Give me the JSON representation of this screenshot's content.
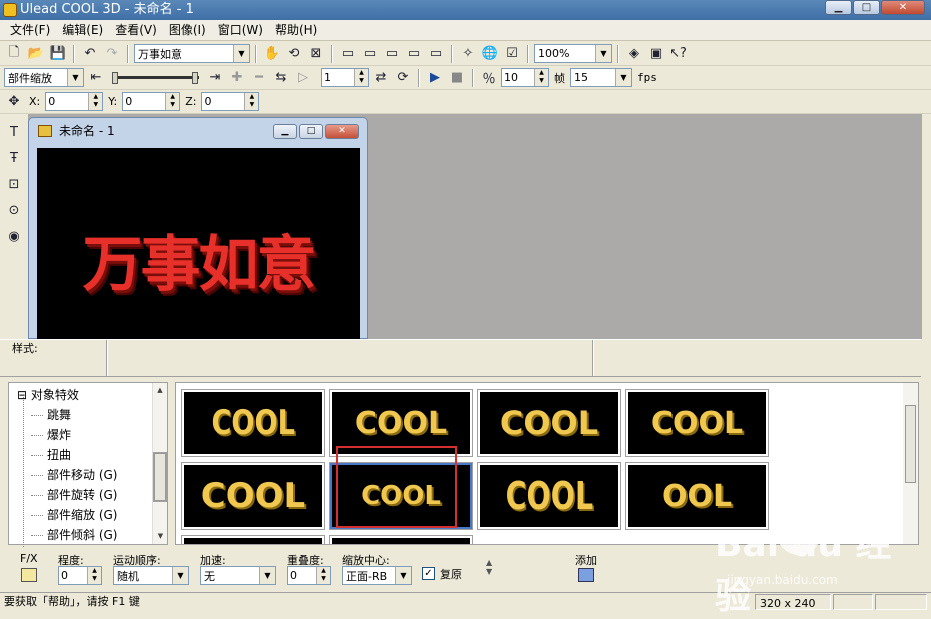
{
  "window": {
    "title": "Ulead COOL 3D - 未命名 - 1"
  },
  "menu": [
    "文件(F)",
    "编辑(E)",
    "查看(V)",
    "图像(I)",
    "窗口(W)",
    "帮助(H)"
  ],
  "toolbar1": {
    "text_combo": "万事如意",
    "zoom": "100%"
  },
  "toolbar2": {
    "mode_combo": "部件缩放",
    "frame": "1",
    "fps_value": "10",
    "frame_label": "帧",
    "frames_total": "15",
    "fps_label": "fps"
  },
  "toolbar3": {
    "x_label": "X:",
    "x": "0",
    "y_label": "Y:",
    "y": "0",
    "z_label": "Z:",
    "z": "0"
  },
  "document": {
    "title": "未命名 - 1",
    "canvas_text": "万事如意"
  },
  "style_bar": {
    "label": "样式:"
  },
  "tree": {
    "root": "对象特效",
    "items": [
      "跳舞",
      "爆炸",
      "扭曲",
      "部件移动 (G)",
      "部件旋转 (G)",
      "部件缩放 (G)",
      "部件倾斜 (G)"
    ]
  },
  "gallery": {
    "thumbs": [
      "COOL",
      "COOL",
      "COOL",
      "COOL",
      "COOL",
      "COOL",
      "COOL",
      "OOL"
    ]
  },
  "bottom": {
    "fx_label": "F/X",
    "degree_label": "程度:",
    "degree": "0",
    "order_label": "运动顺序:",
    "order": "随机",
    "speed_label": "加速:",
    "speed": "无",
    "overlap_label": "重叠度:",
    "overlap": "0",
    "center_label": "缩放中心:",
    "center": "正面-RB",
    "restore_label": "复原",
    "add_label": "添加"
  },
  "status": {
    "help": "要获取「帮助」，请按 F1 键",
    "size": "320 x 240"
  },
  "watermark": {
    "brand": "Bai du 经验",
    "url": "jingyan.baidu.com"
  }
}
